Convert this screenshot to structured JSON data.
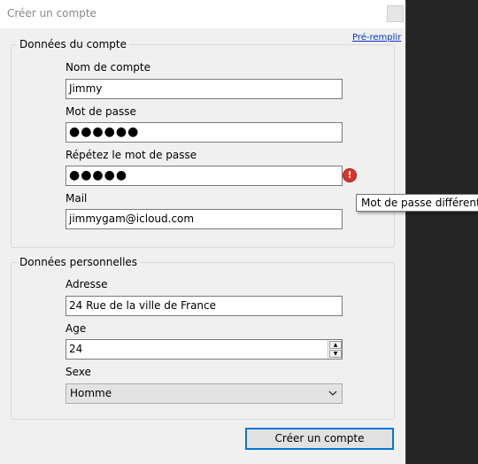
{
  "window": {
    "title": "Créer un compte"
  },
  "prefill_link": "Pré-remplir",
  "account": {
    "legend": "Données du compte",
    "username_label": "Nom de compte",
    "username_value": "Jimmy",
    "password_label": "Mot de passe",
    "password_value": "●●●●●●",
    "repeat_label": "Répétez le mot de passe",
    "repeat_value": "●●●●●",
    "error_icon": "!",
    "error_tooltip": "Mot de passe différent !",
    "mail_label": "Mail",
    "mail_value": "jimmygam@icloud.com"
  },
  "personal": {
    "legend": "Données personnelles",
    "address_label": "Adresse",
    "address_value": "24 Rue de la ville de France",
    "age_label": "Age",
    "age_value": "24",
    "sex_label": "Sexe",
    "sex_value": "Homme"
  },
  "actions": {
    "create_label": "Créer un compte"
  },
  "colors": {
    "error": "#d9342b",
    "focus": "#0078d7",
    "link": "#0033cc"
  }
}
